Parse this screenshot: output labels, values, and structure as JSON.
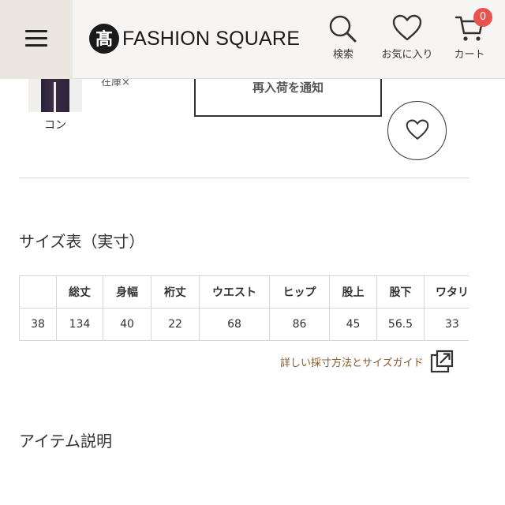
{
  "header": {
    "logo_text": "FASHION SQUARE",
    "logo_mark": "髙",
    "search_label": "検索",
    "favorite_label": "お気に入り",
    "cart_label": "カート",
    "cart_count": "0"
  },
  "product": {
    "color_label": "コン",
    "stock_label": "在庫×",
    "notify_label": "再入荷を通知"
  },
  "size_table": {
    "title": "サイズ表（実寸）",
    "columns": [
      "",
      "総丈",
      "身幅",
      "裄丈",
      "ウエスト",
      "ヒップ",
      "股上",
      "股下",
      "ワタリ"
    ],
    "rows": [
      [
        "38",
        "134",
        "40",
        "22",
        "68",
        "86",
        "45",
        "56.5",
        "33"
      ]
    ],
    "guide_link": "詳しい採寸方法とサイズガイド"
  },
  "description": {
    "title": "アイテム説明"
  },
  "colors": {
    "header_bg": "#f7f5f3",
    "menu_bg": "#ece6e0",
    "badge": "#e8524f",
    "link": "#8a5a2b"
  },
  "icons": {
    "menu": "hamburger-icon",
    "search": "search-icon",
    "favorite": "heart-icon",
    "cart": "cart-icon",
    "external": "external-link-icon"
  }
}
